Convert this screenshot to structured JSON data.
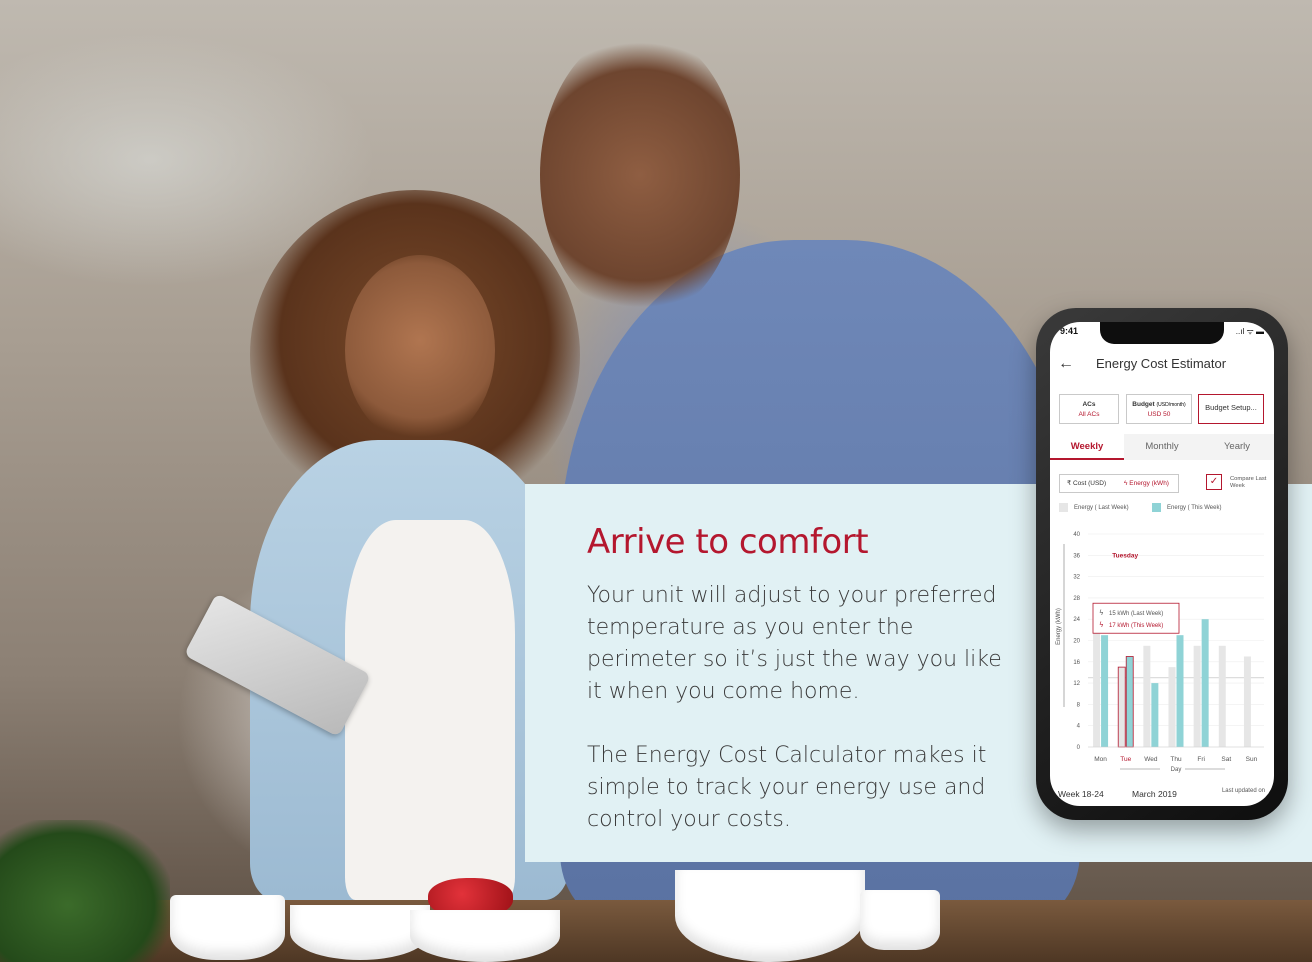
{
  "hero": {
    "headline": "Arrive to comfort",
    "paragraph_1": "Your unit will adjust to your preferred temperature as you enter the perimeter so it’s just the way you like it when you come home.",
    "paragraph_2": "The Energy Cost Calculator makes it simple to track your energy use and control your costs."
  },
  "phone": {
    "status_time": "9:41",
    "status_icons": "..ıl ᯤ ▬",
    "back_icon": "arrow-left-icon",
    "title": "Energy Cost Estimator",
    "selectors": {
      "acs_label": "ACs",
      "acs_value": "All ACs",
      "budget_label": "Budget",
      "budget_unit": "(USD/month)",
      "budget_value": "USD 50",
      "setup_label": "Budget Setup..."
    },
    "tabs": [
      "Weekly",
      "Monthly",
      "Yearly"
    ],
    "active_tab": "Weekly",
    "toggle": {
      "cost_label": "₹ Cost (USD)",
      "energy_label": "ϟ Energy (kWh)"
    },
    "compare_label": "Compare Last Week",
    "legend": {
      "last_week": "Energy ( Last Week)",
      "this_week": "Energy ( This Week)"
    },
    "footer": {
      "week": "Week 18-24",
      "month": "March 2019",
      "updated": "Last updated on"
    }
  },
  "colors": {
    "accent": "#b4172e",
    "panel": "#e1f1f4",
    "bar_this_week": "#8fd3d6",
    "bar_last_week": "#e6e6e6"
  },
  "chart_data": {
    "type": "bar",
    "categories": [
      "Mon",
      "Tue",
      "Wed",
      "Thu",
      "Fri",
      "Sat",
      "Sun"
    ],
    "series": [
      {
        "name": "Energy ( Last Week)",
        "values": [
          23,
          15,
          19,
          15,
          19,
          19,
          17
        ]
      },
      {
        "name": "Energy ( This Week)",
        "values": [
          21,
          17,
          12,
          21,
          24,
          0,
          0
        ]
      }
    ],
    "xlabel": "Day",
    "ylabel": "Energy (kWh)",
    "ylim": [
      0,
      40
    ],
    "yticks": [
      0,
      4,
      8,
      12,
      16,
      20,
      24,
      28,
      32,
      36,
      40
    ],
    "highlight_label": "Tuesday",
    "tooltip": {
      "last_week": "15 kWh (Last Week)",
      "this_week": "17 kWh (This Week)"
    },
    "reference_line": 13,
    "grid": true
  }
}
